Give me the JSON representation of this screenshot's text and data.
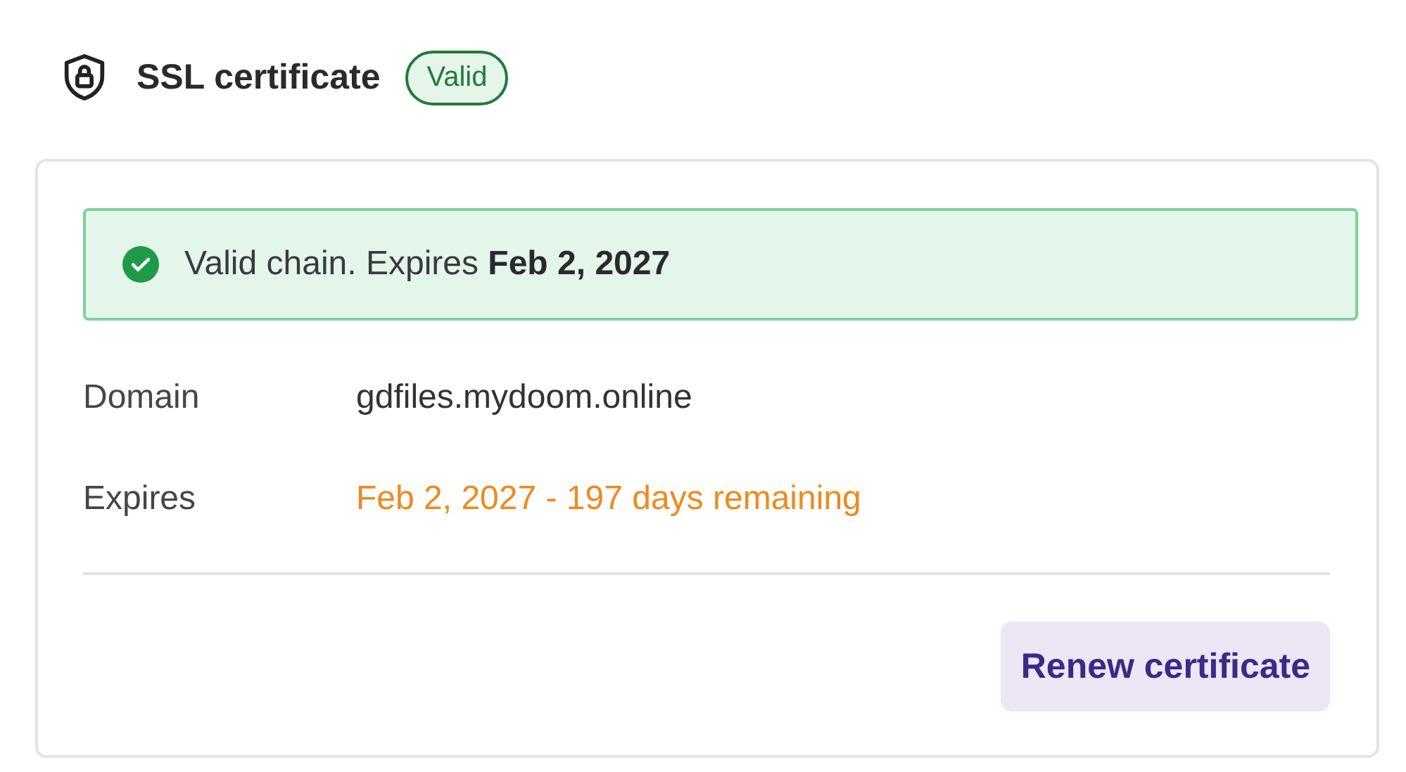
{
  "header": {
    "title": "SSL certificate",
    "badge": {
      "label": "Valid"
    }
  },
  "banner": {
    "kind": "success",
    "text": "Valid chain. Expires **Feb 2, 2027**"
  },
  "details": [
    {
      "label": "Domain",
      "value": "gdfiles.mydoom.online",
      "color": "#333336"
    },
    {
      "label": "Expires",
      "value": "Feb 2, 2027 - 197 days remaining",
      "color": "#ee8a1f"
    }
  ],
  "actions": [
    {
      "label": "Renew certificate"
    }
  ]
}
